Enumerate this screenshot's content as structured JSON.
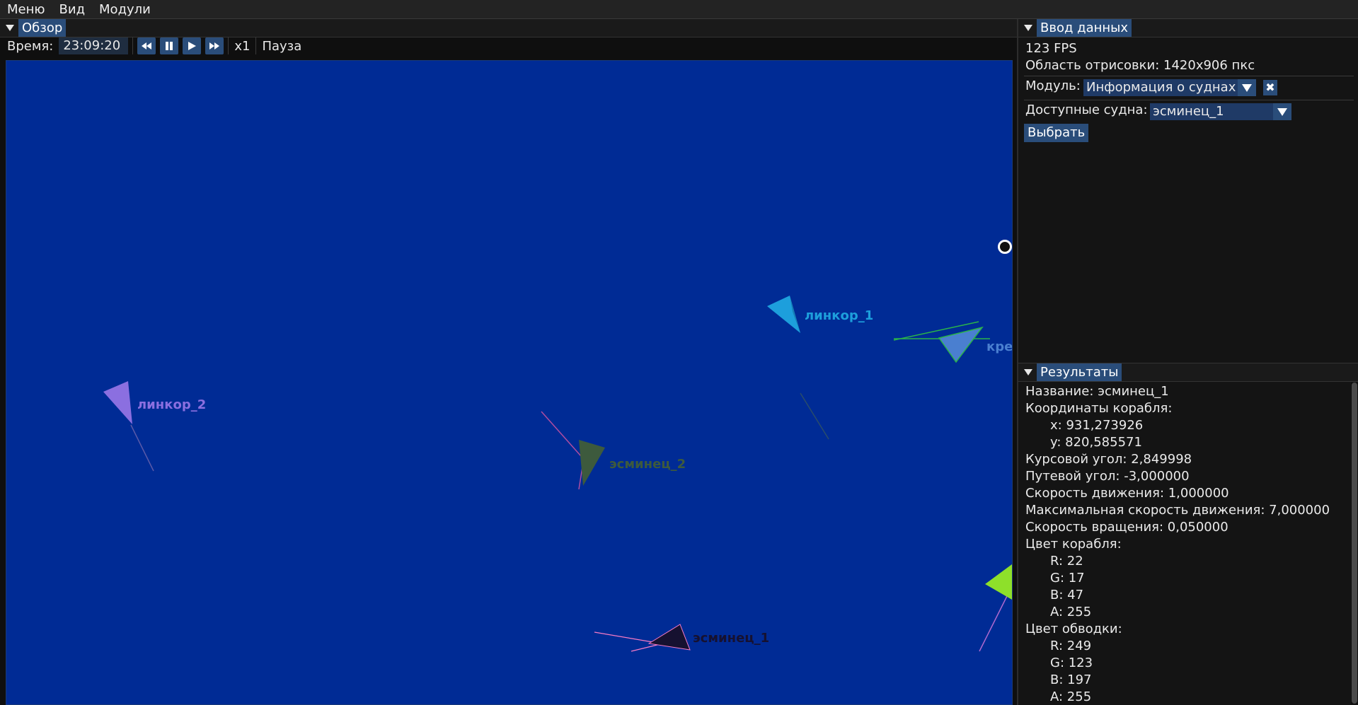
{
  "menu": {
    "items": [
      "Меню",
      "Вид",
      "Модули"
    ]
  },
  "overview": {
    "title": "Обзор",
    "time_label": "Время:",
    "time_value": "23:09:20",
    "speed": "x1",
    "status": "Пауза",
    "ships": [
      {
        "name": "линкор_1",
        "color": "#1d9fdc"
      },
      {
        "name": "линкор_2",
        "color": "#8b6fe0"
      },
      {
        "name": "эсминец_2",
        "color": "#3d5a3d"
      },
      {
        "name": "эсминец_1",
        "color": "#161130"
      },
      {
        "name": "кре",
        "color": "#4a7fd0"
      }
    ]
  },
  "input_panel": {
    "title": "Ввод данных",
    "fps": "123 FPS",
    "render_area": "Область отрисовки: 1420x906 пкс",
    "module_label": "Модуль:",
    "module_value": "Информация о суднах",
    "ships_label": "Доступные судна:",
    "ships_value": "эсминец_1",
    "select_button": "Выбрать"
  },
  "results_panel": {
    "title": "Результаты",
    "lines": [
      "Название: эсминец_1",
      "Координаты корабля:",
      "x: 931,273926",
      "y: 820,585571",
      "Курсовой угол: 2,849998",
      "Путевой угол: -3,000000",
      "Скорость движения: 1,000000",
      "Максимальная скорость движения: 7,000000",
      "Скорость вращения: 0,050000",
      "Цвет корабля:",
      "R: 22",
      "G: 17",
      "B: 47",
      "A: 255",
      "Цвет обводки:",
      "R: 249",
      "G: 123",
      "B: 197",
      "A: 255"
    ]
  },
  "colors": {
    "viewport_bg": "#002b95",
    "accent": "#2a4d7a"
  }
}
